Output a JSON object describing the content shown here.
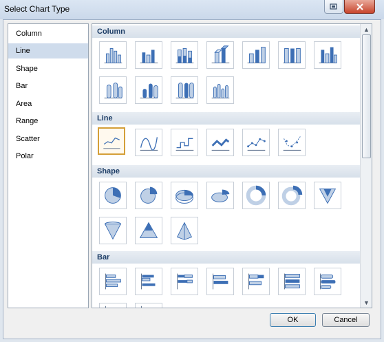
{
  "window": {
    "title": "Select Chart Type",
    "help_icon": "help-icon",
    "close_icon": "close-icon"
  },
  "categories": [
    "Column",
    "Line",
    "Shape",
    "Bar",
    "Area",
    "Range",
    "Scatter",
    "Polar"
  ],
  "selected_category": "Line",
  "sections": [
    "Column",
    "Line",
    "Shape",
    "Bar"
  ],
  "buttons": {
    "ok": "OK",
    "cancel": "Cancel"
  },
  "colors": {
    "accent": "#d49f38",
    "blue": "#3d6fb5"
  }
}
